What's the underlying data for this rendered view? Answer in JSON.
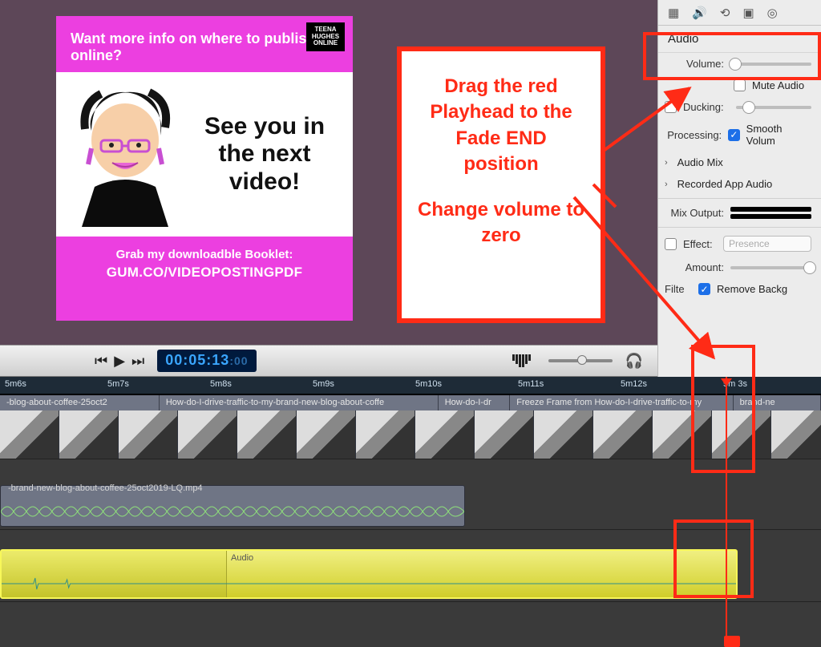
{
  "preview": {
    "top_text": "Want more info on where to publish online?",
    "badge_lines": [
      "TEENA",
      "HUGHES",
      "ONLINE"
    ],
    "mid_text": "See you in the next video!",
    "bottom_line1": "Grab my downloadble Booklet:",
    "bottom_line2": "GUM.CO/VIDEOPOSTINGPDF"
  },
  "callout": {
    "line1": "Drag the red Playhead to the Fade END position",
    "line2": "Change volume to zero"
  },
  "inspector": {
    "section": "Audio",
    "volume_label": "Volume:",
    "mute_label": "Mute Audio",
    "ducking_label": "Ducking:",
    "processing_label": "Processing:",
    "smooth_label": "Smooth Volum",
    "audio_mix_label": "Audio Mix",
    "recorded_label": "Recorded App Audio",
    "mix_output_label": "Mix Output:",
    "effect_label": "Effect:",
    "effect_value": "Presence",
    "amount_label": "Amount:",
    "filter_label": "Filte",
    "remove_bg_label": "Remove Backg"
  },
  "playbar": {
    "timecode_main": "00:05:13",
    "timecode_frac": ":00"
  },
  "timeline": {
    "ticks": [
      "5m6s",
      "5m7s",
      "5m8s",
      "5m9s",
      "5m10s",
      "5m11s",
      "5m12s",
      "5m 3s"
    ],
    "video_clips": [
      "-blog-about-coffee-25oct2",
      "How-do-I-drive-traffic-to-my-brand-new-blog-about-coffe",
      "How-do-I-dr",
      "Freeze Frame from How-do-I-drive-traffic-to-my",
      "brand-ne"
    ],
    "audio1_label": "-brand-new-blog-about-coffee-25oct2019-LQ.mp4",
    "audio2_inner_label": "Audio"
  }
}
